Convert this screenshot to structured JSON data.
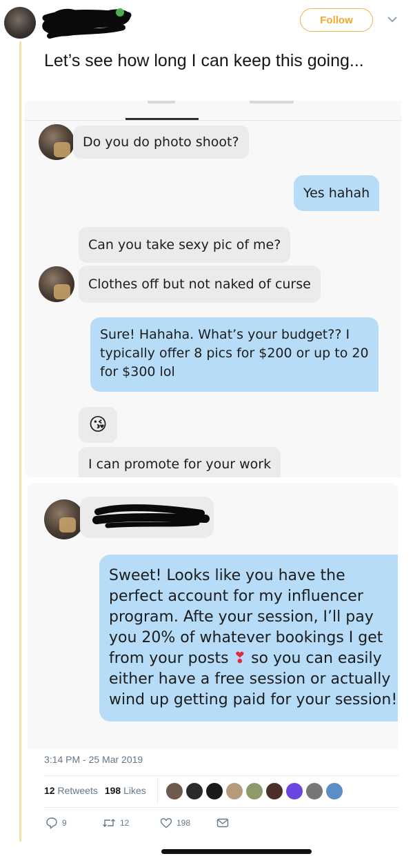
{
  "header": {
    "follow_label": "Follow"
  },
  "tweet": {
    "text": "Let’s see how long I can keep this going..."
  },
  "screenshot1": {
    "messages": [
      {
        "side": "in",
        "text": "Do you do photo shoot?"
      },
      {
        "side": "out",
        "text": "Yes hahah"
      },
      {
        "side": "in",
        "text": "Can you take sexy pic of me?"
      },
      {
        "side": "in",
        "text": "Clothes off but not naked of curse"
      },
      {
        "side": "out",
        "text": "Sure! Hahaha. What’s your budget?? I typically offer 8 pics for $200 or up to 20 for $300 lol"
      },
      {
        "side": "in",
        "text": "😘"
      },
      {
        "side": "in",
        "text": "I can promote for your work"
      }
    ]
  },
  "screenshot2": {
    "message_part1": "Sweet! Looks like you have the perfect account for my influencer program. Afte your session, I’ll pay you 20% of whatever bookings I get from your posts",
    "heart": "❣",
    "message_part2": "so you can easily either have a free session or actually wind up getting paid for your session!"
  },
  "meta": {
    "timestamp": "3:14 PM - 25 Mar 2019",
    "retweets_count": "12",
    "retweets_label": "Retweets",
    "likes_count": "198",
    "likes_label": "Likes",
    "reply_count": "9",
    "retweet_action_count": "12",
    "like_action_count": "198"
  },
  "colors": {
    "accent": "#f0a82b",
    "outgoing_bubble": "#b7dcf7",
    "incoming_bubble": "#ebebeb",
    "thread_line": "#f6dfa8"
  }
}
